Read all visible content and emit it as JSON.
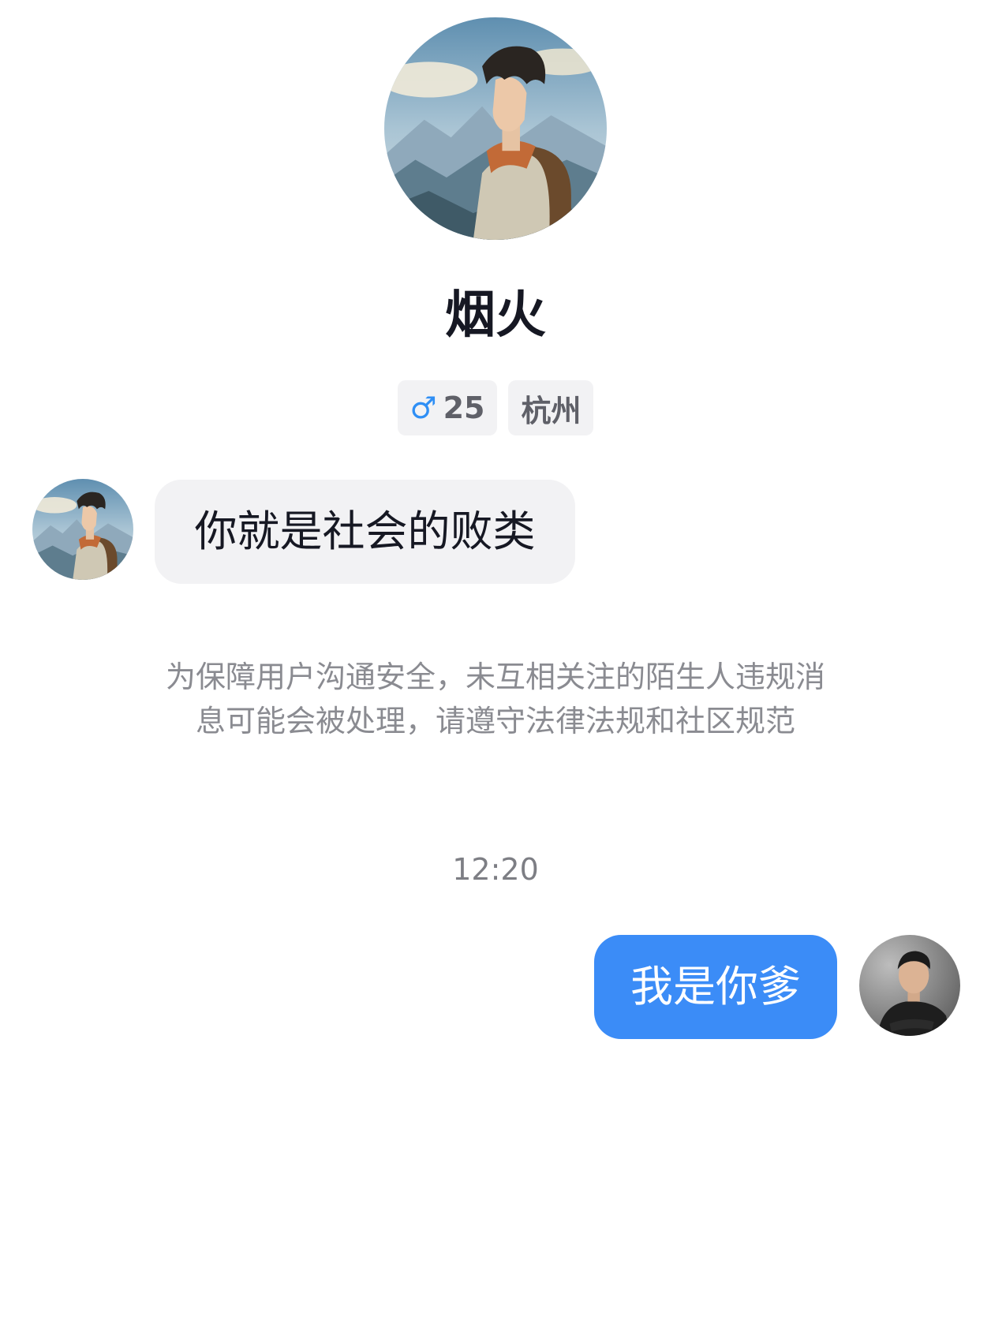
{
  "profile": {
    "name": "烟火",
    "gender_icon": "male-icon",
    "gender_symbol": "♂",
    "age": "25",
    "city": "杭州"
  },
  "messages": [
    {
      "direction": "incoming",
      "text": "你就是社会的败类"
    },
    {
      "direction": "outgoing",
      "text": "我是你爹"
    }
  ],
  "notice": "为保障用户沟通安全，未互相关注的陌生人违规消息可能会被处理，请遵守法律法规和社区规范",
  "timestamp": "12:20",
  "colors": {
    "outgoing_bubble": "#3b8cf7",
    "incoming_bubble": "#f2f2f4",
    "gender_male": "#2f8ff5"
  }
}
